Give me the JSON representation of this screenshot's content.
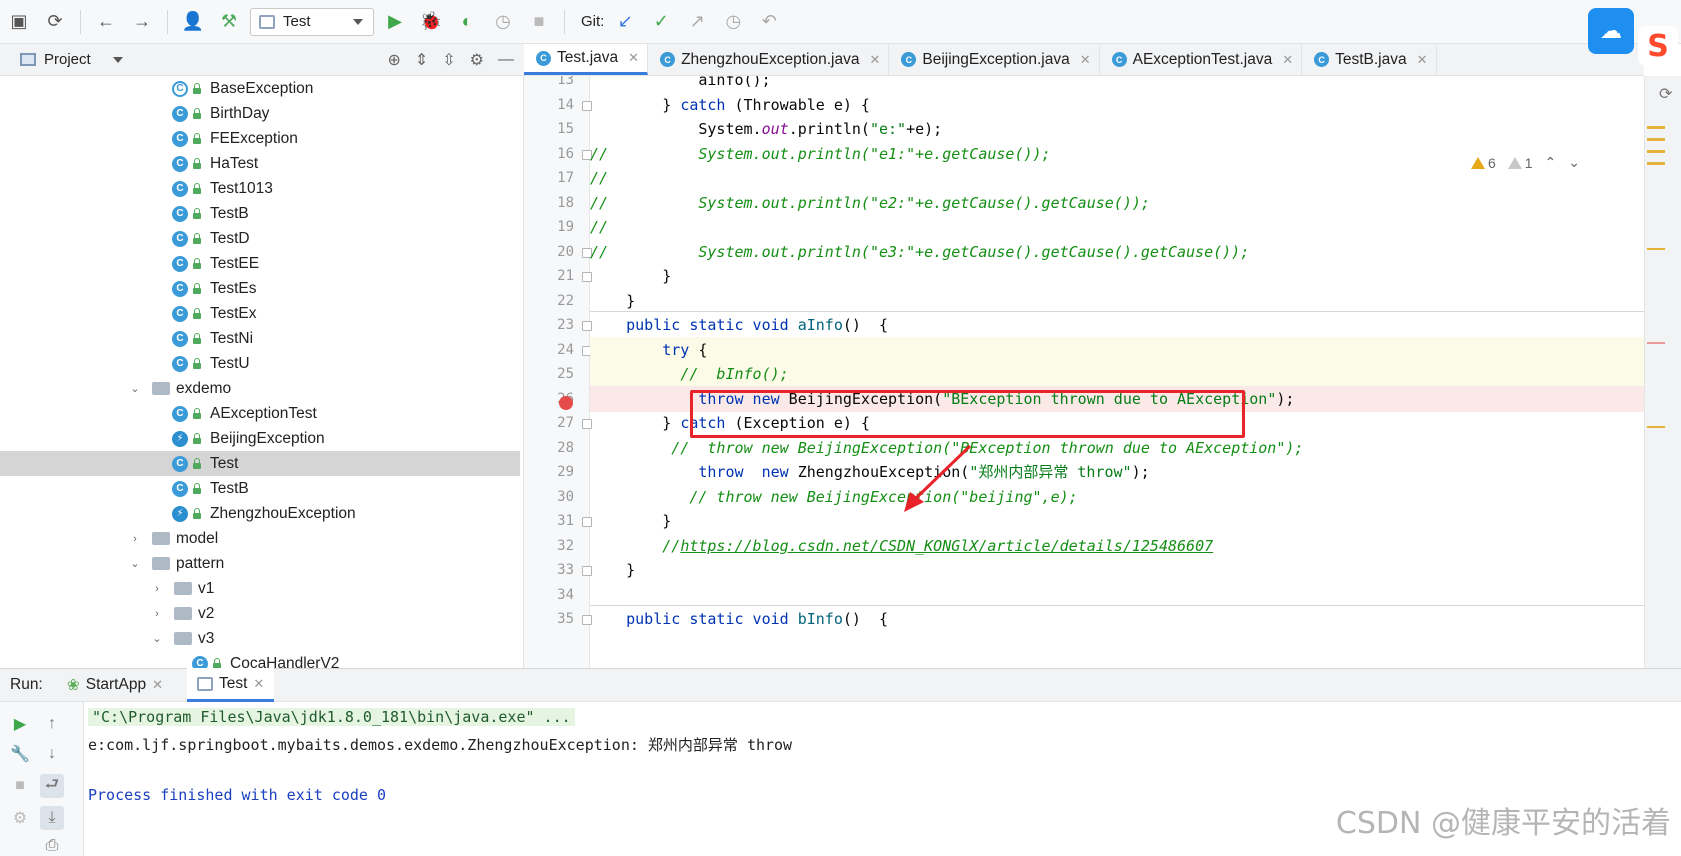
{
  "toolbar": {
    "run_config": "Test",
    "git_label": "Git:"
  },
  "project_panel": {
    "title": "Project",
    "tree": [
      {
        "label": "BaseException",
        "kind": "abstract"
      },
      {
        "label": "BirthDay",
        "kind": "class"
      },
      {
        "label": "FEException",
        "kind": "class"
      },
      {
        "label": "HaTest",
        "kind": "class"
      },
      {
        "label": "Test1013",
        "kind": "class"
      },
      {
        "label": "TestB",
        "kind": "class"
      },
      {
        "label": "TestD",
        "kind": "class"
      },
      {
        "label": "TestEE",
        "kind": "class"
      },
      {
        "label": "TestEs",
        "kind": "class"
      },
      {
        "label": "TestEx",
        "kind": "class"
      },
      {
        "label": "TestNi",
        "kind": "class"
      },
      {
        "label": "TestU",
        "kind": "class"
      },
      {
        "label": "exdemo",
        "kind": "folder-open"
      },
      {
        "label": "AExceptionTest",
        "kind": "class"
      },
      {
        "label": "BeijingException",
        "kind": "exc"
      },
      {
        "label": "Test",
        "kind": "class",
        "selected": true
      },
      {
        "label": "TestB",
        "kind": "class"
      },
      {
        "label": "ZhengzhouException",
        "kind": "exc"
      },
      {
        "label": "model",
        "kind": "folder-closed"
      },
      {
        "label": "pattern",
        "kind": "folder-open"
      },
      {
        "label": "v1",
        "kind": "folder-closed"
      },
      {
        "label": "v2",
        "kind": "folder-closed"
      },
      {
        "label": "v3",
        "kind": "folder-open"
      },
      {
        "label": "CocaHandlerV2",
        "kind": "class"
      }
    ]
  },
  "editor": {
    "tabs": [
      {
        "label": "Test.java",
        "active": true
      },
      {
        "label": "ZhengzhouException.java"
      },
      {
        "label": "BeijingException.java"
      },
      {
        "label": "AExceptionTest.java"
      },
      {
        "label": "TestB.java"
      }
    ],
    "warnings": "6",
    "weak_warnings": "1",
    "line_numbers": [
      "13",
      "14",
      "15",
      "16",
      "17",
      "18",
      "19",
      "20",
      "21",
      "22",
      "23",
      "24",
      "25",
      "26",
      "27",
      "28",
      "29",
      "30",
      "31",
      "32",
      "33",
      "34",
      "35"
    ],
    "lines": {
      "l13": "ainfo();",
      "l14_kw": "catch",
      "l14a": "} ",
      "l14b": " (Throwable e) {",
      "l15a": "System.",
      "l15_field": "out",
      "l15b": ".println(",
      "l15_str": "\"e:\"",
      "l15c": "+e);",
      "l16": "//          System.out.println(\"e1:\"+e.getCause());",
      "l17": "//",
      "l18": "//          System.out.println(\"e2:\"+e.getCause().getCause());",
      "l19": "//",
      "l20": "//          System.out.println(\"e3:\"+e.getCause().getCause().getCause());",
      "l21": "}",
      "l22": "}",
      "l23_kw": "public static void",
      "l23_fn": "aInfo",
      "l23b": "()  {",
      "l24_kw": "try",
      "l24b": " {",
      "l25": "//  bInfo();",
      "l26_kw": "throw new",
      "l26a": " BeijingException(",
      "l26_str": "\"BException thrown due to AException\"",
      "l26b": ");",
      "l27a": "} ",
      "l27_kw": "catch",
      "l27b": " (Exception e) {",
      "l28": "//  throw new BeijingException(\"BException thrown due to AException\");",
      "l29_kw1": "throw",
      "l29_kw2": "new",
      "l29a": " ZhengzhouException(",
      "l29_str": "\"郑州内部异常 throw\"",
      "l29b": ");",
      "l30": "// throw new BeijingException(\"beijing\",e);",
      "l31": "}",
      "l32a": "//",
      "l32_link": "https://blog.csdn.net/CSDN_KONGlX/article/details/125486607",
      "l33": "}",
      "l34": "",
      "l35_kw": "public static void",
      "l35_fn": "bInfo",
      "l35b": "()  {"
    }
  },
  "run_panel": {
    "label": "Run:",
    "tabs": [
      "StartApp",
      "Test"
    ],
    "console": [
      "\"C:\\Program Files\\Java\\jdk1.8.0_181\\bin\\java.exe\" ...",
      "e:com.ljf.springboot.mybaits.demos.exdemo.ZhengzhouException: 郑州内部异常 throw",
      "",
      "Process finished with exit code 0"
    ]
  },
  "watermark": "CSDN @健康平安的活着",
  "overlay_badge": "S",
  "colors": {
    "keyword": "#0033b3",
    "string": "#067d17",
    "comment": "#148f14",
    "highlight_box": "#e8232a",
    "breakpoint": "#e64b4b"
  }
}
